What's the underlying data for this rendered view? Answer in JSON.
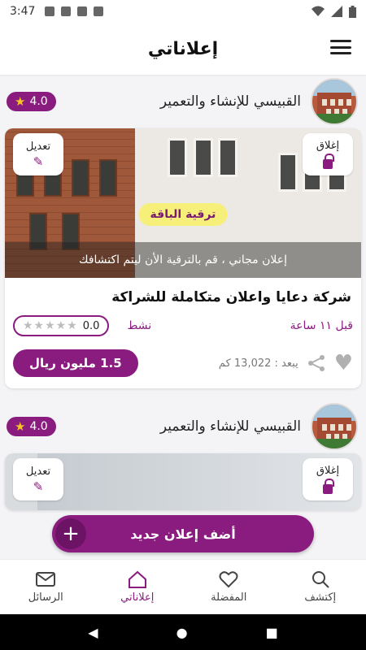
{
  "status_bar": {
    "time": "3:47"
  },
  "app_bar": {
    "title": "إعلاناتي"
  },
  "listings": [
    {
      "company": {
        "name": "القبيسي للإنشاء والتعمير",
        "rating": "4.0"
      },
      "edit_label": "تعديل",
      "close_label": "إغلاق",
      "upgrade_label": "ترقية الباقة",
      "overlay_text": "إعلان مجاني ، قم بالترقية الأن ليتم اكتشافك",
      "title": "شركة دعايا واعلان متكاملة للشراكة",
      "time": "قبل ١١ ساعة",
      "status": "نشط",
      "review_score": "0.0",
      "distance": "يبعد : 13,022 كم",
      "price": "1.5 مليون ريال"
    },
    {
      "company": {
        "name": "القبيسي للإنشاء والتعمير",
        "rating": "4.0"
      },
      "edit_label": "تعديل",
      "close_label": "إغلاق"
    }
  ],
  "add_button": {
    "label": "أضف إعلان جديد"
  },
  "bottom_nav": {
    "items": [
      {
        "label": "الرسائل",
        "icon": "mail-icon"
      },
      {
        "label": "إعلاناتي",
        "icon": "home-icon",
        "active": true
      },
      {
        "label": "المفضلة",
        "icon": "heart-icon"
      },
      {
        "label": "إكتشف",
        "icon": "search-icon"
      }
    ]
  },
  "colors": {
    "accent": "#8a1b7f",
    "upgrade": "#f6ef7a",
    "star": "#f7c325"
  }
}
